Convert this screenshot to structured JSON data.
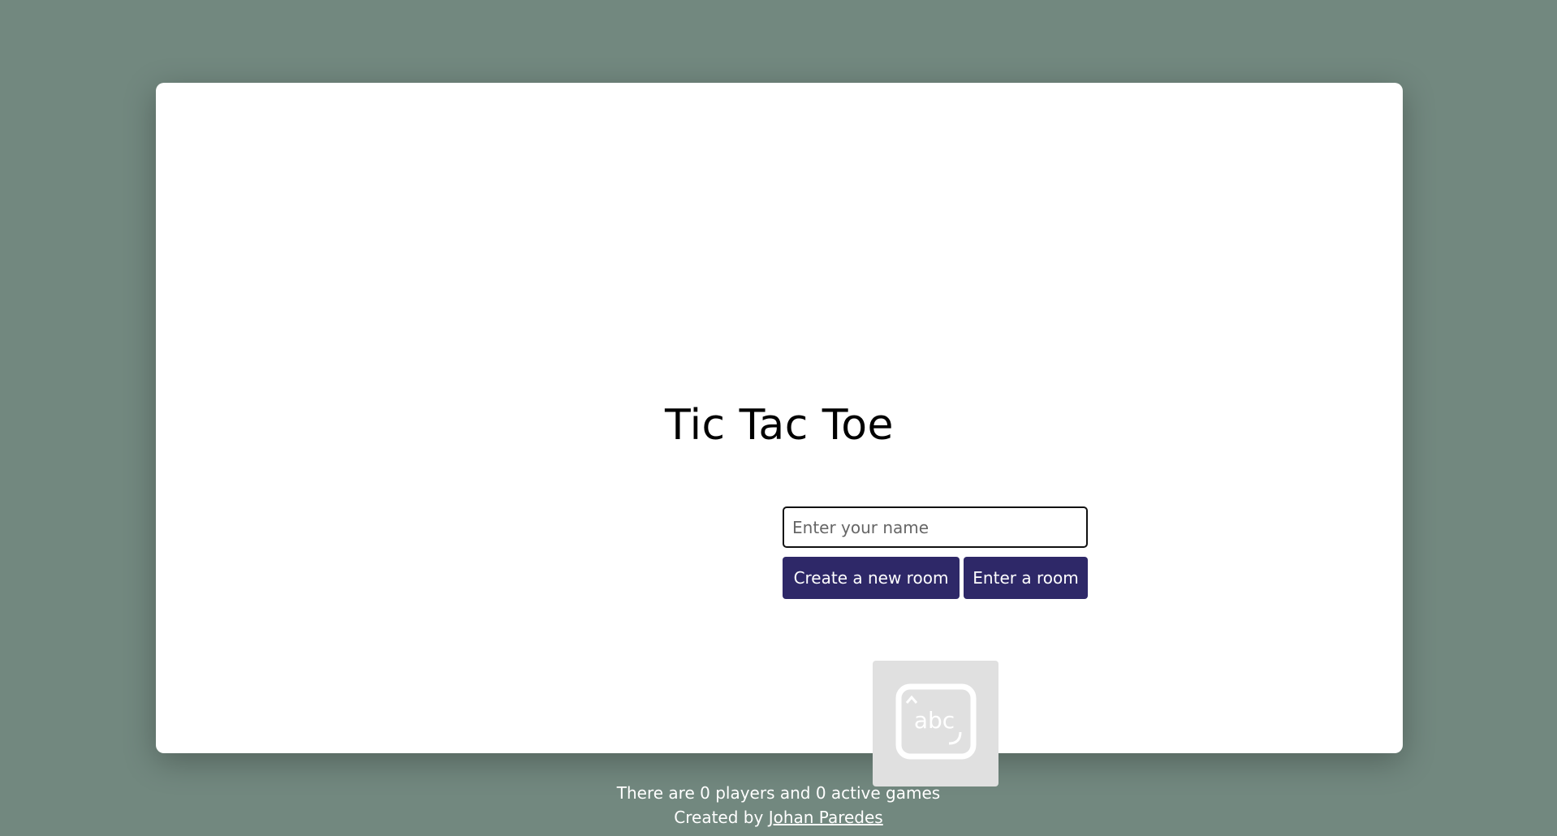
{
  "title": "Tic Tac Toe",
  "name_input": {
    "placeholder": "Enter your name",
    "value": ""
  },
  "buttons": {
    "create_label": "Create a new room",
    "enter_label": "Enter a room"
  },
  "image": {
    "icon": "text-input-icon",
    "text": "abc"
  },
  "footer": {
    "stats": "There are 0 players and 0 active games",
    "credit_prefix": "Created by",
    "author": "Johan Paredes"
  },
  "colors": {
    "background": "#72887f",
    "card": "#ffffff",
    "button": "#2e2868",
    "image_placeholder": "#e0e0e0"
  }
}
